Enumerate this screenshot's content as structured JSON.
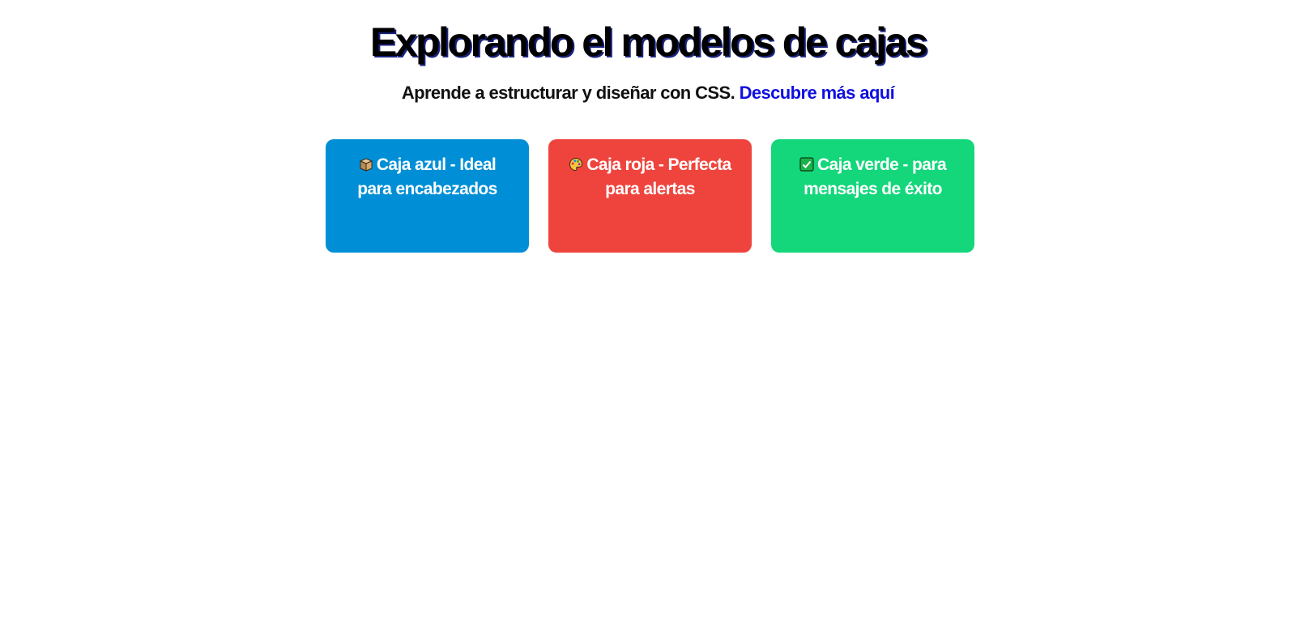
{
  "header": {
    "title": "Explorando el modelos de cajas",
    "subtitle_text": "Aprende a estructurar y diseñar con CSS.",
    "subtitle_link": "Descubre más aquí"
  },
  "cards": [
    {
      "icon": "package-icon",
      "text": "Caja azul - Ideal para encabezados",
      "color": "#008fd6"
    },
    {
      "icon": "palette-icon",
      "text": "Caja roja - Perfecta para alertas",
      "color": "#ef443d"
    },
    {
      "icon": "check-mark-icon",
      "text": "Caja verde - para mensajes de éxito",
      "color": "#14d67b"
    }
  ]
}
